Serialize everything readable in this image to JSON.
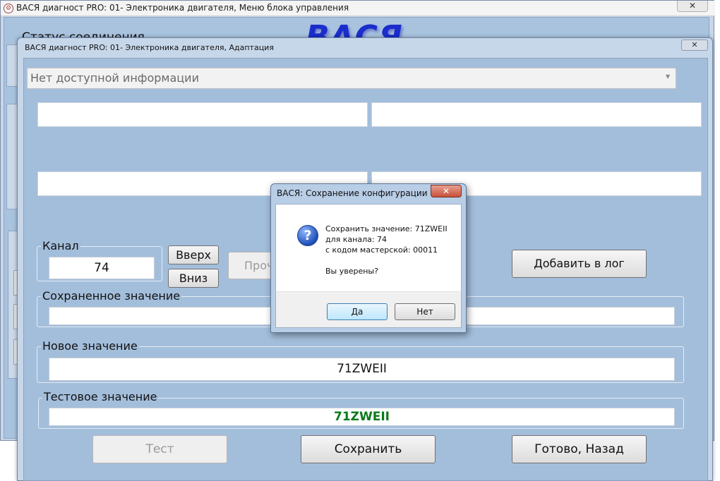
{
  "main_window": {
    "title": "ВАСЯ диагност PRO: 01- Электроника двигателя,  Меню блока управления",
    "close_glyph": "✕",
    "status_label": "Статус соединения",
    "logo_text": "ВАСЯ"
  },
  "adapt_window": {
    "title": "ВАСЯ диагност PRO: 01- Электроника двигателя, Адаптация",
    "close_glyph": "✕",
    "info_select": {
      "value": "Нет доступной информации",
      "arrow": "▼"
    },
    "channel": {
      "label": "Канал",
      "value": "74",
      "up_button": "Вверх",
      "down_button": "Вниз"
    },
    "read_button": "Прочитать",
    "add_log_button": "Добавить в лог",
    "saved_value": {
      "label": "Сохраненное значение",
      "value": ""
    },
    "new_value": {
      "label": "Новое значение",
      "value": "71ZWEII"
    },
    "test_value": {
      "label": "Тестовое значение",
      "value": "71ZWEII",
      "color": "#0a7a1a"
    },
    "buttons": {
      "test": "Тест",
      "save": "Сохранить",
      "done": "Готово, Назад"
    }
  },
  "dialog": {
    "title": "ВАСЯ: Сохранение конфигурации",
    "close_glyph": "✕",
    "icon": "question-icon",
    "icon_glyph": "?",
    "message_lines": [
      "Сохранить значение: 71ZWEII",
      "для канала: 74",
      "с кодом мастерской: 00011"
    ],
    "confirm": "Вы уверены?",
    "yes_button": "Да",
    "no_button": "Нет"
  },
  "colors": {
    "accent": "#1a2ecc",
    "window_blue": "#a3bedb",
    "success_green": "#0a7a1a"
  }
}
